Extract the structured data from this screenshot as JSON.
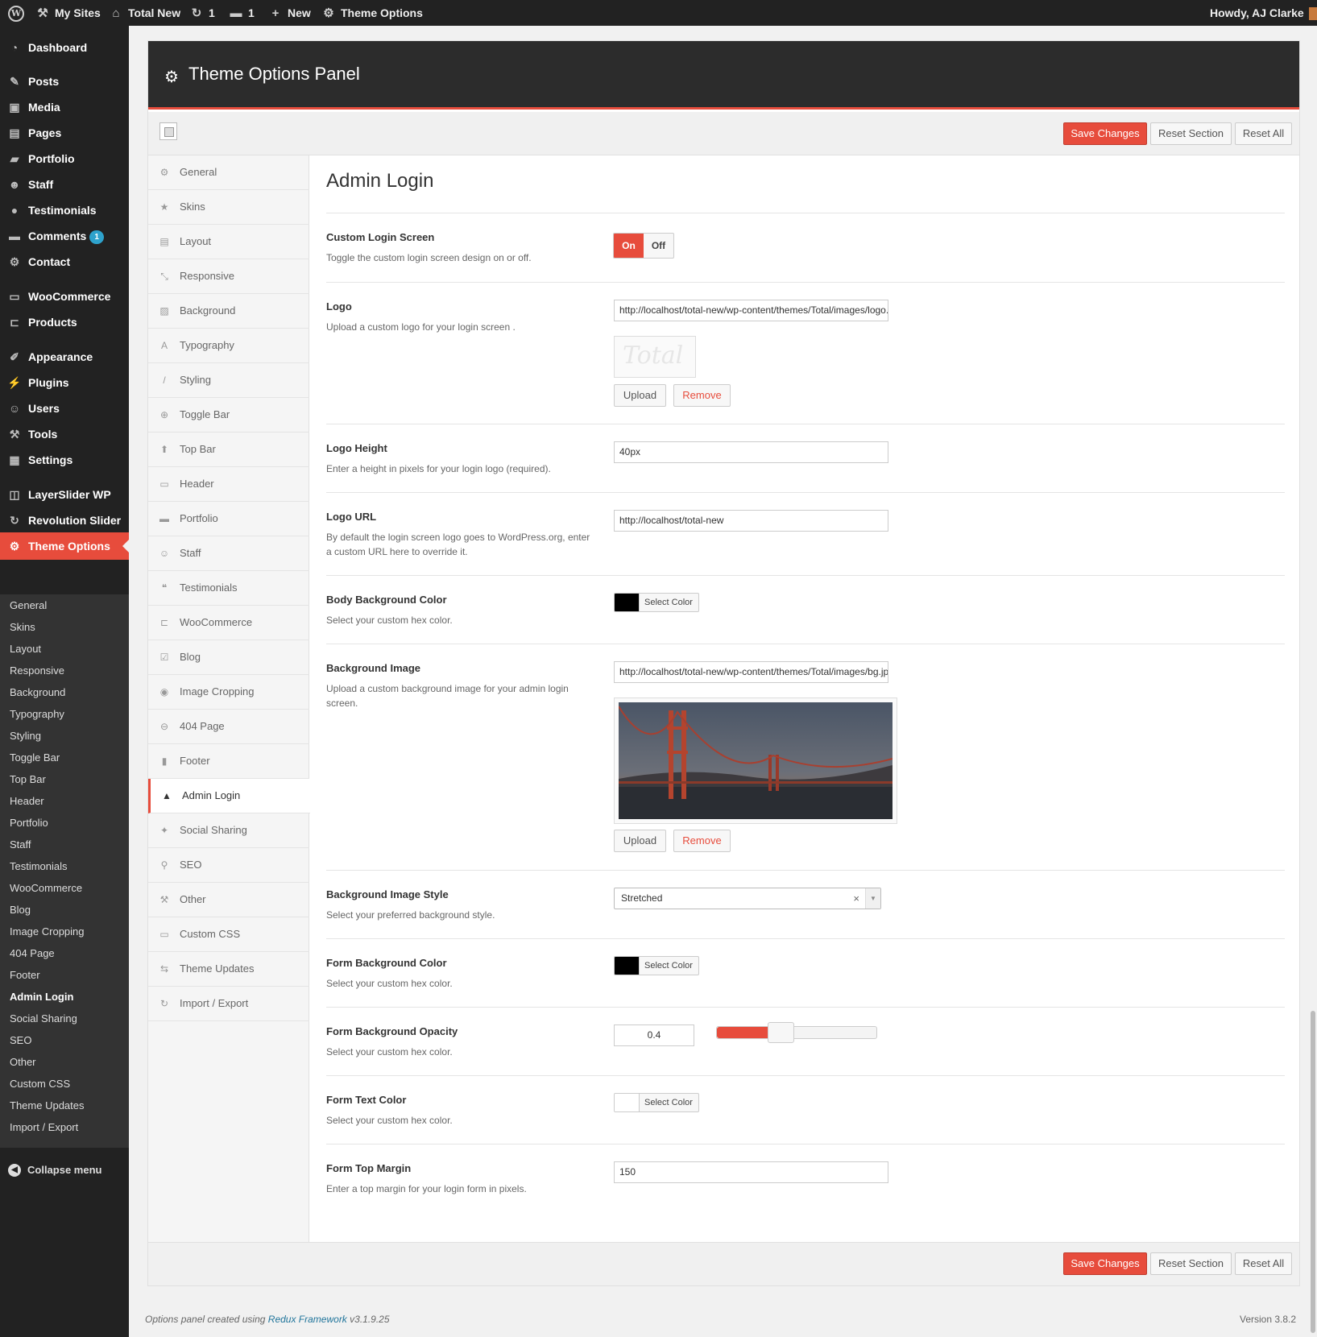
{
  "admin_bar": {
    "wp_icon": "wordpress-icon",
    "my_sites": "My Sites",
    "site_name": "Total New",
    "updates_count": "1",
    "comments_count": "1",
    "new_label": "New",
    "theme_options": "Theme Options",
    "howdy": "Howdy, AJ Clarke"
  },
  "admin_menu": {
    "items": [
      {
        "label": "Dashboard",
        "icon": "dashboard-icon"
      },
      {
        "label": "Posts",
        "icon": "pin-icon"
      },
      {
        "label": "Media",
        "icon": "media-icon"
      },
      {
        "label": "Pages",
        "icon": "pages-icon"
      },
      {
        "label": "Portfolio",
        "icon": "folder-icon"
      },
      {
        "label": "Staff",
        "icon": "staff-icon"
      },
      {
        "label": "Testimonials",
        "icon": "speech-icon"
      },
      {
        "label": "Comments",
        "icon": "comment-icon",
        "badge": "1"
      },
      {
        "label": "Contact",
        "icon": "gear-icon"
      },
      {
        "label": "WooCommerce",
        "icon": "woo-icon"
      },
      {
        "label": "Products",
        "icon": "cart-icon"
      },
      {
        "label": "Appearance",
        "icon": "brush-icon"
      },
      {
        "label": "Plugins",
        "icon": "plug-icon"
      },
      {
        "label": "Users",
        "icon": "user-icon"
      },
      {
        "label": "Tools",
        "icon": "wrench-icon"
      },
      {
        "label": "Settings",
        "icon": "sliders-icon"
      },
      {
        "label": "LayerSlider WP",
        "icon": "layers-icon"
      },
      {
        "label": "Revolution Slider",
        "icon": "refresh-icon"
      },
      {
        "label": "Theme Options",
        "icon": "gear-icon"
      }
    ],
    "submenu": [
      "General",
      "Skins",
      "Layout",
      "Responsive",
      "Background",
      "Typography",
      "Styling",
      "Toggle Bar",
      "Top Bar",
      "Header",
      "Portfolio",
      "Staff",
      "Testimonials",
      "WooCommerce",
      "Blog",
      "Image Cropping",
      "404 Page",
      "Footer",
      "Admin Login",
      "Social Sharing",
      "SEO",
      "Other",
      "Custom CSS",
      "Theme Updates",
      "Import / Export"
    ],
    "collapse": "Collapse menu"
  },
  "panel": {
    "title": "Theme Options Panel",
    "save": "Save Changes",
    "reset_section": "Reset Section",
    "reset_all": "Reset All"
  },
  "tabs": [
    {
      "label": "General",
      "icon": "gear-icon"
    },
    {
      "label": "Skins",
      "icon": "star-icon"
    },
    {
      "label": "Layout",
      "icon": "layout-icon"
    },
    {
      "label": "Responsive",
      "icon": "resize-icon"
    },
    {
      "label": "Background",
      "icon": "picture-icon"
    },
    {
      "label": "Typography",
      "icon": "font-icon"
    },
    {
      "label": "Styling",
      "icon": "pencil-icon"
    },
    {
      "label": "Toggle Bar",
      "icon": "plus-circle-icon"
    },
    {
      "label": "Top Bar",
      "icon": "arrow-up-icon"
    },
    {
      "label": "Header",
      "icon": "monitor-icon"
    },
    {
      "label": "Portfolio",
      "icon": "briefcase-icon"
    },
    {
      "label": "Staff",
      "icon": "user-icon"
    },
    {
      "label": "Testimonials",
      "icon": "quote-icon"
    },
    {
      "label": "WooCommerce",
      "icon": "cart-icon"
    },
    {
      "label": "Blog",
      "icon": "edit-icon"
    },
    {
      "label": "Image Cropping",
      "icon": "camera-icon"
    },
    {
      "label": "404 Page",
      "icon": "minus-circle-icon"
    },
    {
      "label": "Footer",
      "icon": "bookmark-icon"
    },
    {
      "label": "Admin Login",
      "icon": "lock-icon",
      "active": true
    },
    {
      "label": "Social Sharing",
      "icon": "twitter-icon"
    },
    {
      "label": "SEO",
      "icon": "search-icon"
    },
    {
      "label": "Other",
      "icon": "wrench-icon"
    },
    {
      "label": "Custom CSS",
      "icon": "css-icon"
    },
    {
      "label": "Theme Updates",
      "icon": "retweet-icon"
    },
    {
      "label": "Import / Export",
      "icon": "refresh-icon"
    }
  ],
  "section": {
    "title": "Admin Login",
    "fields": {
      "custom_login": {
        "title": "Custom Login Screen",
        "desc": "Toggle the custom login screen design on or off.",
        "on": "On",
        "off": "Off",
        "value": "On"
      },
      "logo": {
        "title": "Logo",
        "desc": "Upload a custom logo for your login screen .",
        "value": "http://localhost/total-new/wp-content/themes/Total/images/logo.png",
        "preview_text": "Total",
        "upload": "Upload",
        "remove": "Remove"
      },
      "logo_height": {
        "title": "Logo Height",
        "desc": "Enter a height in pixels for your login logo (required).",
        "value": "40px"
      },
      "logo_url": {
        "title": "Logo URL",
        "desc": "By default the login screen logo goes to WordPress.org, enter a custom URL here to override it.",
        "value": "http://localhost/total-new"
      },
      "body_bg_color": {
        "title": "Body Background Color",
        "desc": "Select your custom hex color.",
        "button": "Select Color",
        "color": "#000000"
      },
      "bg_image": {
        "title": "Background Image",
        "desc": "Upload a custom background image for your admin login screen.",
        "value": "http://localhost/total-new/wp-content/themes/Total/images/bg.jpg",
        "upload": "Upload",
        "remove": "Remove"
      },
      "bg_image_style": {
        "title": "Background Image Style",
        "desc": "Select your preferred background style.",
        "value": "Stretched"
      },
      "form_bg_color": {
        "title": "Form Background Color",
        "desc": "Select your custom hex color.",
        "button": "Select Color",
        "color": "#000000"
      },
      "form_bg_opacity": {
        "title": "Form Background Opacity",
        "desc": "Select your custom hex color.",
        "value": "0.4",
        "fraction": 0.4
      },
      "form_text_color": {
        "title": "Form Text Color",
        "desc": "Select your custom hex color.",
        "button": "Select Color",
        "color": "#ffffff"
      },
      "form_top_margin": {
        "title": "Form Top Margin",
        "desc": "Enter a top margin for your login form in pixels.",
        "value": "150"
      }
    }
  },
  "footer": {
    "left_prefix": "Options panel created using",
    "link": "Redux Framework",
    "left_suffix": "v3.1.9.25",
    "version": "Version 3.8.2"
  },
  "colors": {
    "accent": "#e74c3c",
    "admin_bar": "#222222",
    "panel_header": "#2c2c2c"
  }
}
